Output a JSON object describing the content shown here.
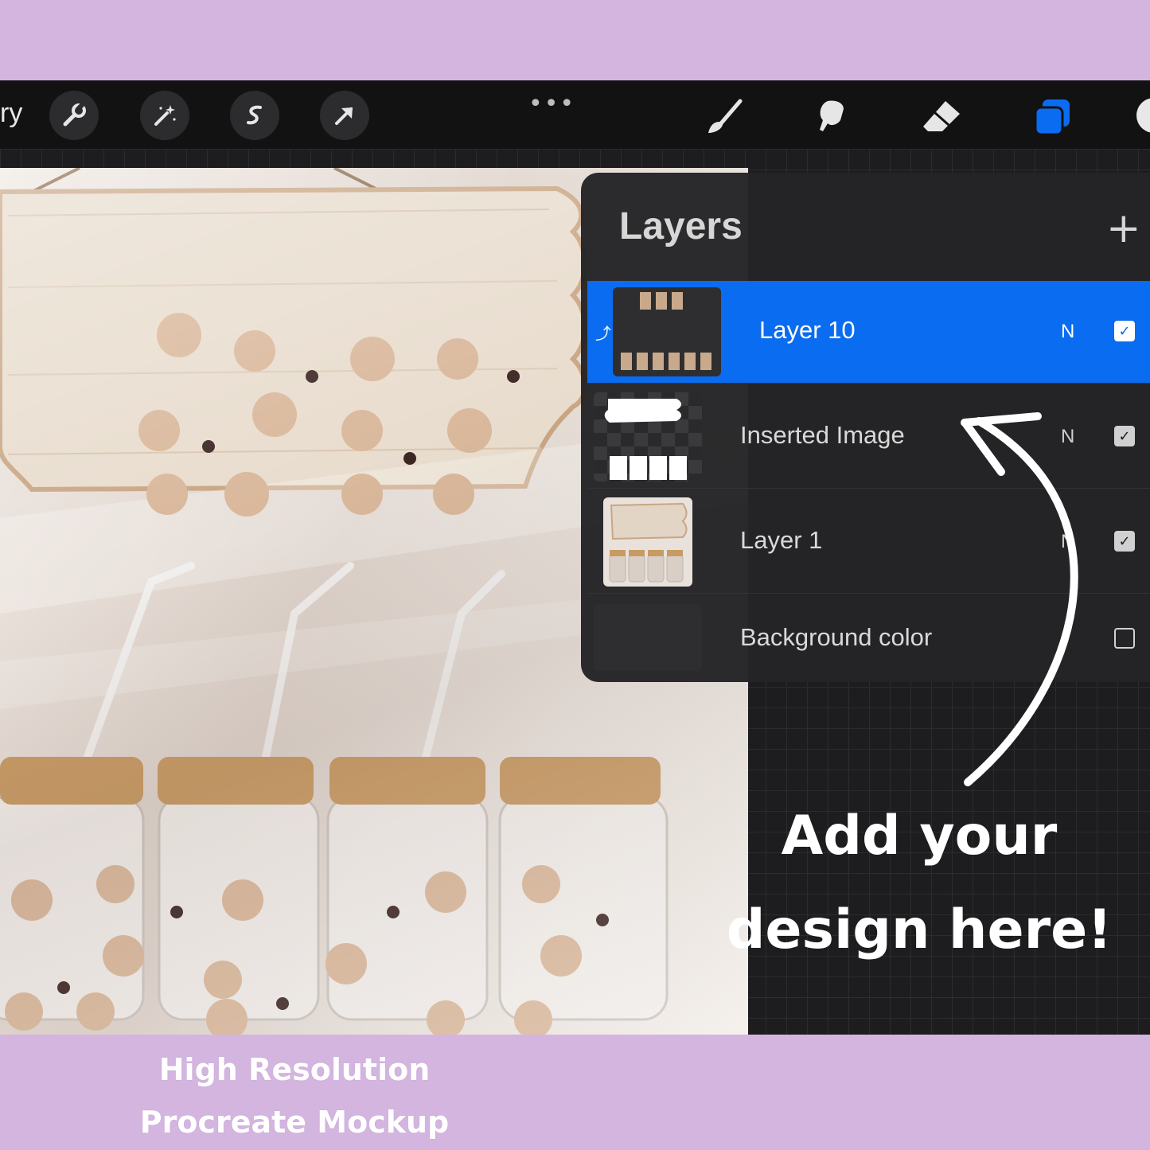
{
  "toolbar": {
    "gallery_fragment": "ry",
    "left_tools": [
      "wrench-icon",
      "magic-wand-icon",
      "selection-icon",
      "move-arrow-icon"
    ],
    "more_label": "•••",
    "right_tools": [
      "brush-icon",
      "smudge-icon",
      "eraser-icon",
      "layers-icon"
    ],
    "active_tool": "layers-icon",
    "active_color": "#0a6cf0"
  },
  "layers_panel": {
    "title": "Layers",
    "add_label": "+",
    "layers": [
      {
        "name": "Layer 10",
        "blend": "N",
        "visible": true,
        "selected": true,
        "clipped": true
      },
      {
        "name": "Inserted Image",
        "blend": "N",
        "visible": true,
        "selected": false,
        "clipped": false
      },
      {
        "name": "Layer 1",
        "blend": "N",
        "visible": true,
        "selected": false,
        "clipped": false
      },
      {
        "name": "Background color",
        "blend": "",
        "visible": false,
        "selected": false,
        "clipped": false
      }
    ]
  },
  "callout": {
    "line1": "Add your",
    "line2": "design here!"
  },
  "footer": {
    "line1": "High Resolution",
    "line2": "Procreate Mockup"
  },
  "colors": {
    "band": "#d3b5e0",
    "selected_row": "#0a6cf0"
  }
}
